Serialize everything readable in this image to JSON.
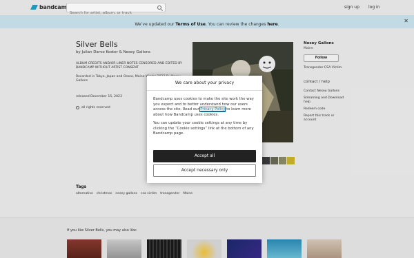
{
  "header": {
    "logo_text": "bandcamp",
    "search_placeholder": "Search for artist, album, or track",
    "signup": "sign up",
    "login": "log in"
  },
  "banner": {
    "prefix": "We’ve updated our ",
    "terms": "Terms of Use",
    "middle": ". You can review the changes ",
    "here": "here",
    "suffix": "."
  },
  "album": {
    "title": "Silver Bells",
    "byline": "by Julian Darvo Koster & Nesey Gallons",
    "credits": "ALBUM CREDITS AND/OR LINER NOTES CENSORED AND EDITED BY BANDCAMP WITHOUT ARTIST CONSENT",
    "recorded": "Recorded in Tokyo, Japan and Orono, Maine Winter 2022 By Nesey Gallons",
    "released": "released December 15, 2023",
    "rights": "all rights reserved"
  },
  "sidebar": {
    "name": "Nesey Gallons",
    "location": "Maine",
    "follow": "Follow",
    "bio": "Transgender CSA Victim.",
    "contact_heading": "contact / help",
    "links": [
      "Contact Nesey Gallons",
      "Streaming and Download help",
      "Redeem code",
      "Report this track or account"
    ]
  },
  "tags": {
    "heading": "Tags",
    "items": [
      "alternative",
      "christmas",
      "nesey gallons",
      "csa victim",
      "transgender",
      "Maine"
    ]
  },
  "recommendations": {
    "heading": "If you like Silver Bells, you may also like:"
  },
  "cookie_modal": {
    "title": "We care about your privacy",
    "p1_before": "Bandcamp uses cookies to make the site work the way you expect and to better understand how our users access the site. Read our ",
    "p1_link": "Privacy Policy",
    "p1_after": " to learn more about how Bandcamp uses cookies.",
    "p2": "You can update your cookie settings at any time by clicking the “Cookie settings” link at the bottom of any Bandcamp page.",
    "accept_all": "Accept all",
    "accept_necessary": "Accept necessary only"
  },
  "colors": {
    "brand": "#1da0c3",
    "banner": "#c9e3ee",
    "accept_button": "#222222"
  }
}
